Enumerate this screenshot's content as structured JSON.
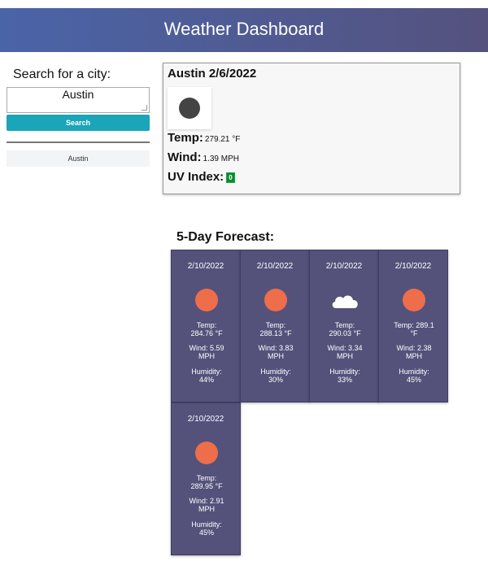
{
  "header": {
    "title": "Weather Dashboard"
  },
  "sidebar": {
    "search_label": "Search for a city:",
    "search_value": "Austin",
    "search_button": "Search",
    "history": [
      "Austin"
    ]
  },
  "current": {
    "title": "Austin 2/6/2022",
    "icon": "moon-icon",
    "temp_label": "Temp:",
    "temp_value": "279.21 °F",
    "wind_label": "Wind:",
    "wind_value": "1.39 MPH",
    "uv_label": "UV Index:",
    "uv_value": "0"
  },
  "forecast": {
    "title": "5-Day Forecast:",
    "days": [
      {
        "date": "2/10/2022",
        "icon": "sun-icon",
        "temp_a": "Temp:",
        "temp_b": "284.76 °F",
        "wind_a": "Wind: 5.59",
        "wind_b": "MPH",
        "hum_a": "Humidity:",
        "hum_b": "44%"
      },
      {
        "date": "2/10/2022",
        "icon": "sun-icon",
        "temp_a": "Temp:",
        "temp_b": "288.13 °F",
        "wind_a": "Wind: 3.83",
        "wind_b": "MPH",
        "hum_a": "Humidity:",
        "hum_b": "30%"
      },
      {
        "date": "2/10/2022",
        "icon": "cloud-icon",
        "temp_a": "Temp:",
        "temp_b": "290.03 °F",
        "wind_a": "Wind: 3.34",
        "wind_b": "MPH",
        "hum_a": "Humidity:",
        "hum_b": "33%"
      },
      {
        "date": "2/10/2022",
        "icon": "sun-icon",
        "temp_a": "Temp: 289.1",
        "temp_b": "°F",
        "wind_a": "Wind: 2.38",
        "wind_b": "MPH",
        "hum_a": "Humidity:",
        "hum_b": "45%"
      },
      {
        "date": "2/10/2022",
        "icon": "sun-icon",
        "temp_a": "Temp:",
        "temp_b": "289.95 °F",
        "wind_a": "Wind: 2.91",
        "wind_b": "MPH",
        "hum_a": "Humidity:",
        "hum_b": "45%"
      }
    ]
  }
}
